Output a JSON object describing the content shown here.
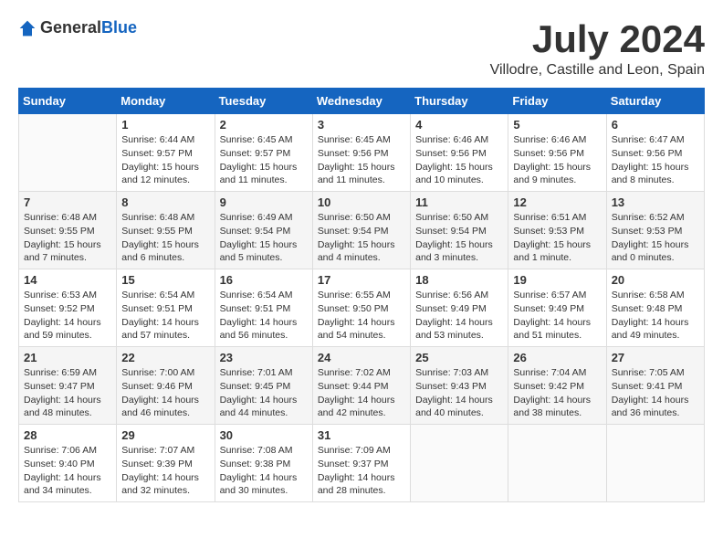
{
  "logo": {
    "general": "General",
    "blue": "Blue"
  },
  "title": "July 2024",
  "subtitle": "Villodre, Castille and Leon, Spain",
  "weekdays": [
    "Sunday",
    "Monday",
    "Tuesday",
    "Wednesday",
    "Thursday",
    "Friday",
    "Saturday"
  ],
  "weeks": [
    [
      {
        "day": "",
        "info": ""
      },
      {
        "day": "1",
        "info": "Sunrise: 6:44 AM\nSunset: 9:57 PM\nDaylight: 15 hours\nand 12 minutes."
      },
      {
        "day": "2",
        "info": "Sunrise: 6:45 AM\nSunset: 9:57 PM\nDaylight: 15 hours\nand 11 minutes."
      },
      {
        "day": "3",
        "info": "Sunrise: 6:45 AM\nSunset: 9:56 PM\nDaylight: 15 hours\nand 11 minutes."
      },
      {
        "day": "4",
        "info": "Sunrise: 6:46 AM\nSunset: 9:56 PM\nDaylight: 15 hours\nand 10 minutes."
      },
      {
        "day": "5",
        "info": "Sunrise: 6:46 AM\nSunset: 9:56 PM\nDaylight: 15 hours\nand 9 minutes."
      },
      {
        "day": "6",
        "info": "Sunrise: 6:47 AM\nSunset: 9:56 PM\nDaylight: 15 hours\nand 8 minutes."
      }
    ],
    [
      {
        "day": "7",
        "info": "Sunrise: 6:48 AM\nSunset: 9:55 PM\nDaylight: 15 hours\nand 7 minutes."
      },
      {
        "day": "8",
        "info": "Sunrise: 6:48 AM\nSunset: 9:55 PM\nDaylight: 15 hours\nand 6 minutes."
      },
      {
        "day": "9",
        "info": "Sunrise: 6:49 AM\nSunset: 9:54 PM\nDaylight: 15 hours\nand 5 minutes."
      },
      {
        "day": "10",
        "info": "Sunrise: 6:50 AM\nSunset: 9:54 PM\nDaylight: 15 hours\nand 4 minutes."
      },
      {
        "day": "11",
        "info": "Sunrise: 6:50 AM\nSunset: 9:54 PM\nDaylight: 15 hours\nand 3 minutes."
      },
      {
        "day": "12",
        "info": "Sunrise: 6:51 AM\nSunset: 9:53 PM\nDaylight: 15 hours\nand 1 minute."
      },
      {
        "day": "13",
        "info": "Sunrise: 6:52 AM\nSunset: 9:53 PM\nDaylight: 15 hours\nand 0 minutes."
      }
    ],
    [
      {
        "day": "14",
        "info": "Sunrise: 6:53 AM\nSunset: 9:52 PM\nDaylight: 14 hours\nand 59 minutes."
      },
      {
        "day": "15",
        "info": "Sunrise: 6:54 AM\nSunset: 9:51 PM\nDaylight: 14 hours\nand 57 minutes."
      },
      {
        "day": "16",
        "info": "Sunrise: 6:54 AM\nSunset: 9:51 PM\nDaylight: 14 hours\nand 56 minutes."
      },
      {
        "day": "17",
        "info": "Sunrise: 6:55 AM\nSunset: 9:50 PM\nDaylight: 14 hours\nand 54 minutes."
      },
      {
        "day": "18",
        "info": "Sunrise: 6:56 AM\nSunset: 9:49 PM\nDaylight: 14 hours\nand 53 minutes."
      },
      {
        "day": "19",
        "info": "Sunrise: 6:57 AM\nSunset: 9:49 PM\nDaylight: 14 hours\nand 51 minutes."
      },
      {
        "day": "20",
        "info": "Sunrise: 6:58 AM\nSunset: 9:48 PM\nDaylight: 14 hours\nand 49 minutes."
      }
    ],
    [
      {
        "day": "21",
        "info": "Sunrise: 6:59 AM\nSunset: 9:47 PM\nDaylight: 14 hours\nand 48 minutes."
      },
      {
        "day": "22",
        "info": "Sunrise: 7:00 AM\nSunset: 9:46 PM\nDaylight: 14 hours\nand 46 minutes."
      },
      {
        "day": "23",
        "info": "Sunrise: 7:01 AM\nSunset: 9:45 PM\nDaylight: 14 hours\nand 44 minutes."
      },
      {
        "day": "24",
        "info": "Sunrise: 7:02 AM\nSunset: 9:44 PM\nDaylight: 14 hours\nand 42 minutes."
      },
      {
        "day": "25",
        "info": "Sunrise: 7:03 AM\nSunset: 9:43 PM\nDaylight: 14 hours\nand 40 minutes."
      },
      {
        "day": "26",
        "info": "Sunrise: 7:04 AM\nSunset: 9:42 PM\nDaylight: 14 hours\nand 38 minutes."
      },
      {
        "day": "27",
        "info": "Sunrise: 7:05 AM\nSunset: 9:41 PM\nDaylight: 14 hours\nand 36 minutes."
      }
    ],
    [
      {
        "day": "28",
        "info": "Sunrise: 7:06 AM\nSunset: 9:40 PM\nDaylight: 14 hours\nand 34 minutes."
      },
      {
        "day": "29",
        "info": "Sunrise: 7:07 AM\nSunset: 9:39 PM\nDaylight: 14 hours\nand 32 minutes."
      },
      {
        "day": "30",
        "info": "Sunrise: 7:08 AM\nSunset: 9:38 PM\nDaylight: 14 hours\nand 30 minutes."
      },
      {
        "day": "31",
        "info": "Sunrise: 7:09 AM\nSunset: 9:37 PM\nDaylight: 14 hours\nand 28 minutes."
      },
      {
        "day": "",
        "info": ""
      },
      {
        "day": "",
        "info": ""
      },
      {
        "day": "",
        "info": ""
      }
    ]
  ]
}
